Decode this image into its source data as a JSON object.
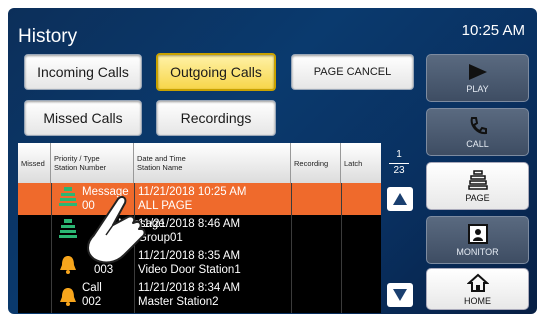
{
  "header": {
    "title": "History",
    "time": "10:25 AM"
  },
  "tabs": {
    "incoming": "Incoming Calls",
    "outgoing": "Outgoing Calls",
    "missed": "Missed Calls",
    "recordings": "Recordings",
    "page_cancel": "PAGE CANCEL"
  },
  "table": {
    "headers": {
      "missed": "Missed",
      "priority_line1": "Priority / Type",
      "priority_line2": "Station Number",
      "datetime_line1": "Date and Time",
      "datetime_line2": "Station Name",
      "recording": "Recording",
      "latch": "Latch"
    },
    "rows": [
      {
        "type": "Message",
        "number": "00",
        "datetime": "11/21/2018 10:25 AM",
        "name": "ALL PAGE",
        "icon": "page-speaker-icon"
      },
      {
        "type": "Message",
        "number": "",
        "datetime": "11/21/2018  8:46 AM",
        "name": "Group01",
        "icon": "page-speaker-icon"
      },
      {
        "type": "",
        "number": "003",
        "datetime": "11/21/2018  8:35 AM",
        "name": "Video Door Station1",
        "icon": "bell-icon"
      },
      {
        "type": "Call",
        "number": "002",
        "datetime": "11/21/2018  8:34 AM",
        "name": "Master Station2",
        "icon": "bell-icon"
      }
    ]
  },
  "pagination": {
    "current": "1",
    "total": "23"
  },
  "side_buttons": {
    "play": "PLAY",
    "call": "CALL",
    "page": "PAGE",
    "monitor": "MONITOR",
    "home": "HOME"
  },
  "colors": {
    "selected_row": "#ef6a2c",
    "active_tab": "#f7d64a",
    "bell": "#f7a51c",
    "page_icon": "#2bb673"
  }
}
